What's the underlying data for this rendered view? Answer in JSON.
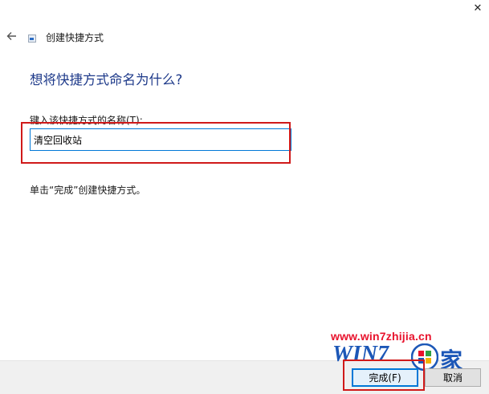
{
  "window": {
    "close_glyph": "✕"
  },
  "wizard": {
    "title": "创建快捷方式",
    "heading": "想将快捷方式命名为什么?",
    "field_label": "键入该快捷方式的名称(T):",
    "name_value": "清空回收站",
    "hint": "单击“完成”创建快捷方式。"
  },
  "footer": {
    "finish_label": "完成(F)",
    "cancel_label": "取消"
  },
  "watermark": {
    "url": "www.win7zhijia.cn",
    "logo_text": "WIN7",
    "logo_char": "家"
  },
  "colors": {
    "heading": "#1e3a8a",
    "highlight": "#d01a1a",
    "accent": "#0078d7",
    "watermark_red": "#e8122c",
    "watermark_blue": "#1c57b7"
  }
}
